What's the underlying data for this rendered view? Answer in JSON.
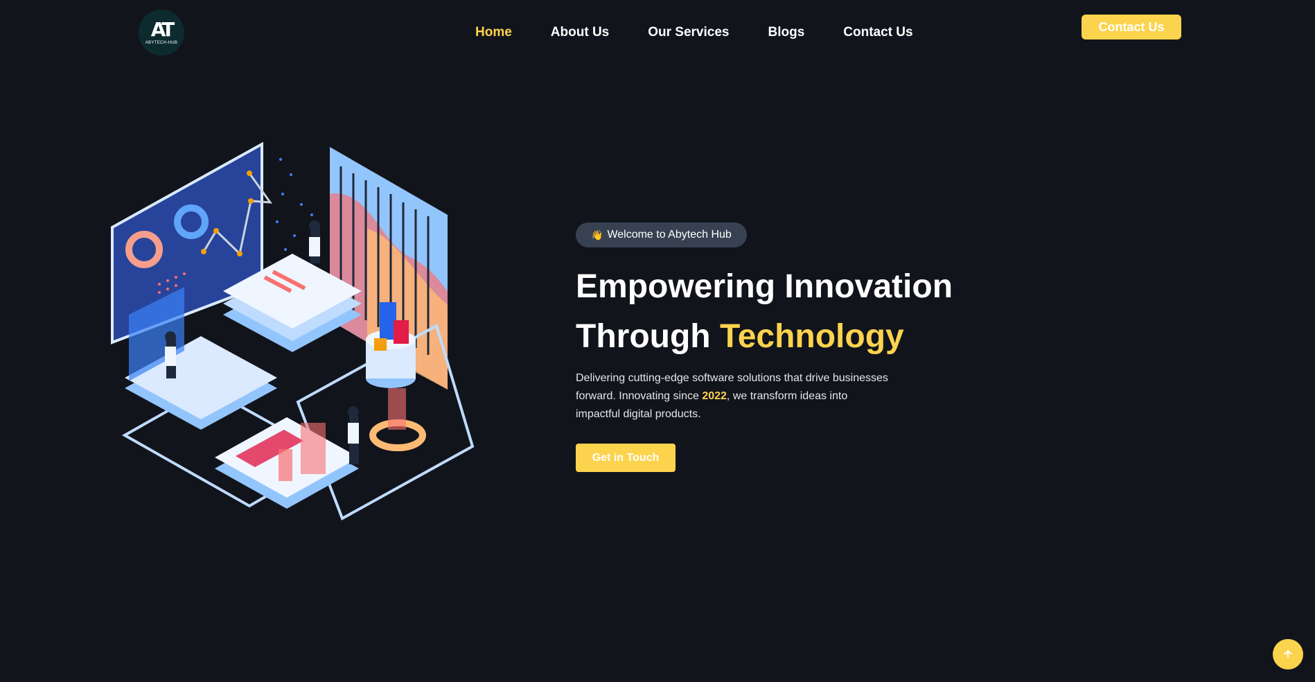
{
  "brand": {
    "logo_mark": "AT",
    "logo_text": "ABYTECH-HUB"
  },
  "nav": {
    "items": [
      {
        "label": "Home",
        "active": true
      },
      {
        "label": "About Us",
        "active": false
      },
      {
        "label": "Our Services",
        "active": false
      },
      {
        "label": "Blogs",
        "active": false
      },
      {
        "label": "Contact Us",
        "active": false
      }
    ],
    "cta_label": "Contact Us"
  },
  "hero": {
    "badge_text": "Welcome to Abytech Hub",
    "badge_icon": "waving-hand-icon",
    "title_line1": "Empowering Innovation",
    "title_line2_prefix": "Through ",
    "title_line2_accent": "Technology",
    "desc_part1": "Delivering cutting-edge software solutions that drive businesses forward. Innovating since ",
    "desc_year": "2022",
    "desc_part2": ", we transform ideas into impactful digital products.",
    "cta_label": "Get in Touch"
  },
  "scroll_top_icon": "arrow-up-icon",
  "colors": {
    "accent": "#fcd34d",
    "background": "#12141c",
    "badge_bg": "#374151"
  }
}
